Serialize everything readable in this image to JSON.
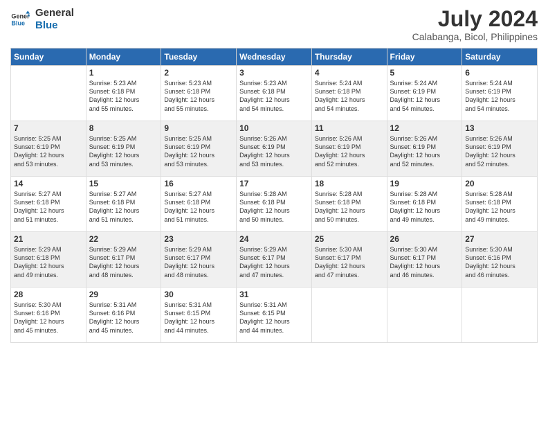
{
  "logo": {
    "line1": "General",
    "line2": "Blue"
  },
  "title": "July 2024",
  "location": "Calabanga, Bicol, Philippines",
  "days_of_week": [
    "Sunday",
    "Monday",
    "Tuesday",
    "Wednesday",
    "Thursday",
    "Friday",
    "Saturday"
  ],
  "weeks": [
    [
      {
        "day": "",
        "sunrise": "",
        "sunset": "",
        "daylight": ""
      },
      {
        "day": "1",
        "sunrise": "Sunrise: 5:23 AM",
        "sunset": "Sunset: 6:18 PM",
        "daylight": "Daylight: 12 hours and 55 minutes."
      },
      {
        "day": "2",
        "sunrise": "Sunrise: 5:23 AM",
        "sunset": "Sunset: 6:18 PM",
        "daylight": "Daylight: 12 hours and 55 minutes."
      },
      {
        "day": "3",
        "sunrise": "Sunrise: 5:23 AM",
        "sunset": "Sunset: 6:18 PM",
        "daylight": "Daylight: 12 hours and 54 minutes."
      },
      {
        "day": "4",
        "sunrise": "Sunrise: 5:24 AM",
        "sunset": "Sunset: 6:18 PM",
        "daylight": "Daylight: 12 hours and 54 minutes."
      },
      {
        "day": "5",
        "sunrise": "Sunrise: 5:24 AM",
        "sunset": "Sunset: 6:19 PM",
        "daylight": "Daylight: 12 hours and 54 minutes."
      },
      {
        "day": "6",
        "sunrise": "Sunrise: 5:24 AM",
        "sunset": "Sunset: 6:19 PM",
        "daylight": "Daylight: 12 hours and 54 minutes."
      }
    ],
    [
      {
        "day": "7",
        "sunrise": "Sunrise: 5:25 AM",
        "sunset": "Sunset: 6:19 PM",
        "daylight": "Daylight: 12 hours and 53 minutes."
      },
      {
        "day": "8",
        "sunrise": "Sunrise: 5:25 AM",
        "sunset": "Sunset: 6:19 PM",
        "daylight": "Daylight: 12 hours and 53 minutes."
      },
      {
        "day": "9",
        "sunrise": "Sunrise: 5:25 AM",
        "sunset": "Sunset: 6:19 PM",
        "daylight": "Daylight: 12 hours and 53 minutes."
      },
      {
        "day": "10",
        "sunrise": "Sunrise: 5:26 AM",
        "sunset": "Sunset: 6:19 PM",
        "daylight": "Daylight: 12 hours and 53 minutes."
      },
      {
        "day": "11",
        "sunrise": "Sunrise: 5:26 AM",
        "sunset": "Sunset: 6:19 PM",
        "daylight": "Daylight: 12 hours and 52 minutes."
      },
      {
        "day": "12",
        "sunrise": "Sunrise: 5:26 AM",
        "sunset": "Sunset: 6:19 PM",
        "daylight": "Daylight: 12 hours and 52 minutes."
      },
      {
        "day": "13",
        "sunrise": "Sunrise: 5:26 AM",
        "sunset": "Sunset: 6:19 PM",
        "daylight": "Daylight: 12 hours and 52 minutes."
      }
    ],
    [
      {
        "day": "14",
        "sunrise": "Sunrise: 5:27 AM",
        "sunset": "Sunset: 6:18 PM",
        "daylight": "Daylight: 12 hours and 51 minutes."
      },
      {
        "day": "15",
        "sunrise": "Sunrise: 5:27 AM",
        "sunset": "Sunset: 6:18 PM",
        "daylight": "Daylight: 12 hours and 51 minutes."
      },
      {
        "day": "16",
        "sunrise": "Sunrise: 5:27 AM",
        "sunset": "Sunset: 6:18 PM",
        "daylight": "Daylight: 12 hours and 51 minutes."
      },
      {
        "day": "17",
        "sunrise": "Sunrise: 5:28 AM",
        "sunset": "Sunset: 6:18 PM",
        "daylight": "Daylight: 12 hours and 50 minutes."
      },
      {
        "day": "18",
        "sunrise": "Sunrise: 5:28 AM",
        "sunset": "Sunset: 6:18 PM",
        "daylight": "Daylight: 12 hours and 50 minutes."
      },
      {
        "day": "19",
        "sunrise": "Sunrise: 5:28 AM",
        "sunset": "Sunset: 6:18 PM",
        "daylight": "Daylight: 12 hours and 49 minutes."
      },
      {
        "day": "20",
        "sunrise": "Sunrise: 5:28 AM",
        "sunset": "Sunset: 6:18 PM",
        "daylight": "Daylight: 12 hours and 49 minutes."
      }
    ],
    [
      {
        "day": "21",
        "sunrise": "Sunrise: 5:29 AM",
        "sunset": "Sunset: 6:18 PM",
        "daylight": "Daylight: 12 hours and 49 minutes."
      },
      {
        "day": "22",
        "sunrise": "Sunrise: 5:29 AM",
        "sunset": "Sunset: 6:17 PM",
        "daylight": "Daylight: 12 hours and 48 minutes."
      },
      {
        "day": "23",
        "sunrise": "Sunrise: 5:29 AM",
        "sunset": "Sunset: 6:17 PM",
        "daylight": "Daylight: 12 hours and 48 minutes."
      },
      {
        "day": "24",
        "sunrise": "Sunrise: 5:29 AM",
        "sunset": "Sunset: 6:17 PM",
        "daylight": "Daylight: 12 hours and 47 minutes."
      },
      {
        "day": "25",
        "sunrise": "Sunrise: 5:30 AM",
        "sunset": "Sunset: 6:17 PM",
        "daylight": "Daylight: 12 hours and 47 minutes."
      },
      {
        "day": "26",
        "sunrise": "Sunrise: 5:30 AM",
        "sunset": "Sunset: 6:17 PM",
        "daylight": "Daylight: 12 hours and 46 minutes."
      },
      {
        "day": "27",
        "sunrise": "Sunrise: 5:30 AM",
        "sunset": "Sunset: 6:16 PM",
        "daylight": "Daylight: 12 hours and 46 minutes."
      }
    ],
    [
      {
        "day": "28",
        "sunrise": "Sunrise: 5:30 AM",
        "sunset": "Sunset: 6:16 PM",
        "daylight": "Daylight: 12 hours and 45 minutes."
      },
      {
        "day": "29",
        "sunrise": "Sunrise: 5:31 AM",
        "sunset": "Sunset: 6:16 PM",
        "daylight": "Daylight: 12 hours and 45 minutes."
      },
      {
        "day": "30",
        "sunrise": "Sunrise: 5:31 AM",
        "sunset": "Sunset: 6:15 PM",
        "daylight": "Daylight: 12 hours and 44 minutes."
      },
      {
        "day": "31",
        "sunrise": "Sunrise: 5:31 AM",
        "sunset": "Sunset: 6:15 PM",
        "daylight": "Daylight: 12 hours and 44 minutes."
      },
      {
        "day": "",
        "sunrise": "",
        "sunset": "",
        "daylight": ""
      },
      {
        "day": "",
        "sunrise": "",
        "sunset": "",
        "daylight": ""
      },
      {
        "day": "",
        "sunrise": "",
        "sunset": "",
        "daylight": ""
      }
    ]
  ]
}
